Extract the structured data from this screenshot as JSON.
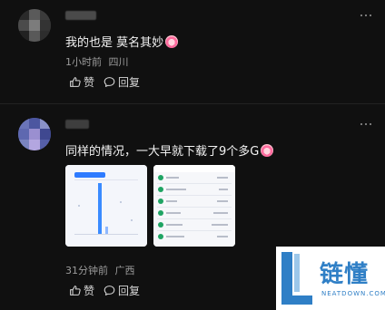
{
  "comments": [
    {
      "text": "我的也是 莫名其妙",
      "emoji_icon": "laughing-crying-emoji",
      "time": "1小时前",
      "location": "四川",
      "like_label": "赞",
      "reply_label": "回复"
    },
    {
      "text": "同样的情况，一大早就下载了9个多G",
      "emoji_icon": "laughing-crying-emoji",
      "time": "31分钟前",
      "location": "广西",
      "like_label": "赞",
      "reply_label": "回复"
    }
  ],
  "watermark": {
    "title": "链懂",
    "subtitle": "NEATDOWN.COM"
  },
  "colors": {
    "background": "#101010",
    "text": "#f2f2f2",
    "meta": "#9c9c9c",
    "watermark_blue": "#2f7fc6"
  }
}
